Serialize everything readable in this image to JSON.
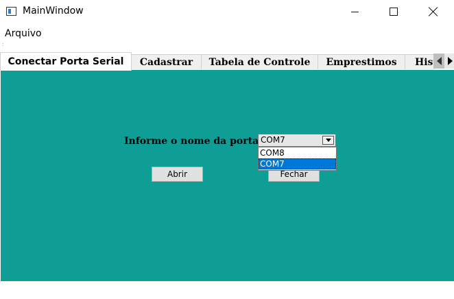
{
  "window": {
    "title": "MainWindow"
  },
  "menu": {
    "items": [
      {
        "label": "Arquivo"
      }
    ]
  },
  "tabs": [
    {
      "label": "Conectar Porta Serial",
      "active": true
    },
    {
      "label": "Cadastrar"
    },
    {
      "label": "Tabela de Controle"
    },
    {
      "label": "Emprestimos"
    },
    {
      "label": "Hist"
    }
  ],
  "serial": {
    "port_label": "Informe o nome da porta:",
    "selected_port": "COM7",
    "port_options": [
      "COM8",
      "COM7"
    ],
    "highlighted_option": "COM7",
    "open_button": "Abrir",
    "close_button": "Fechar"
  },
  "colors": {
    "content_background": "#0f9e96",
    "selection": "#0078d7"
  },
  "icons": {
    "app": "app-window-icon",
    "minimize": "minimize-icon",
    "maximize": "maximize-icon",
    "close": "close-icon",
    "tab_scroll_left": "chevron-left-icon",
    "tab_scroll_right": "chevron-right-icon",
    "dropdown": "chevron-down-icon"
  }
}
